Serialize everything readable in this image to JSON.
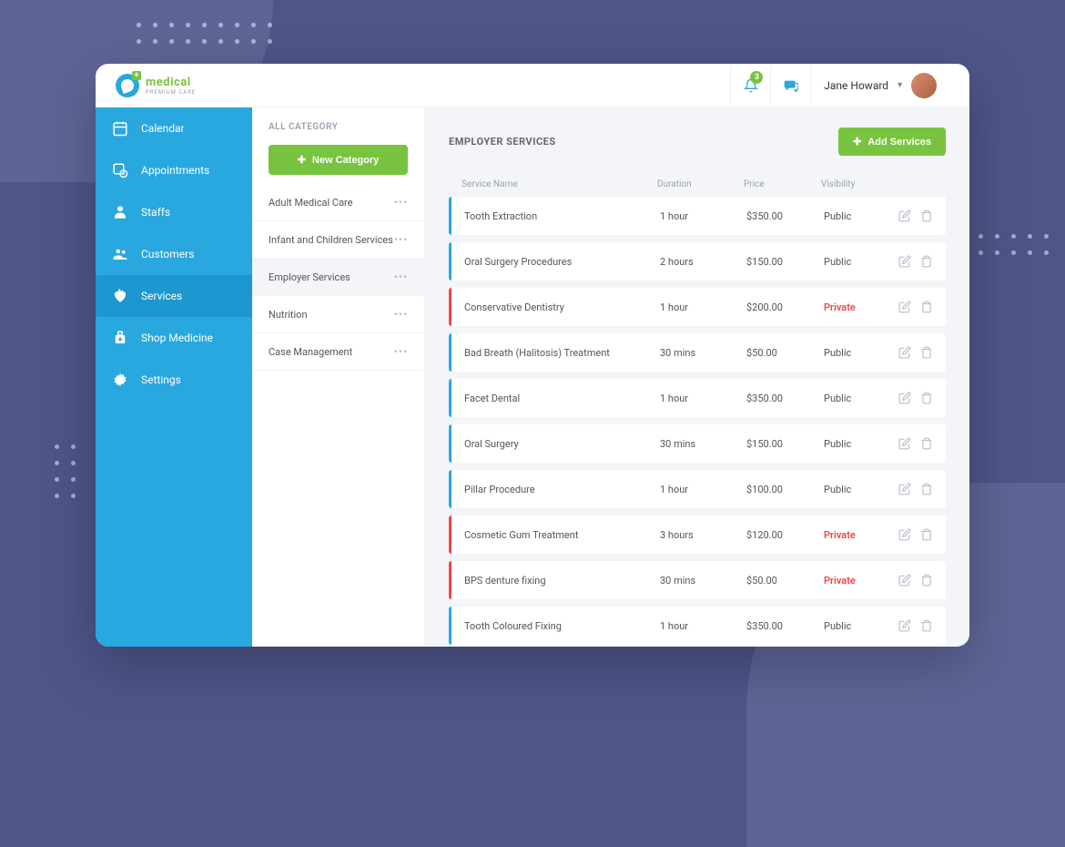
{
  "brand": {
    "name": "medical",
    "tagline": "PREMIUM CARE"
  },
  "topbar": {
    "notification_count": "3",
    "user_name": "Jane Howard"
  },
  "sidebar": {
    "items": [
      {
        "label": "Calendar"
      },
      {
        "label": "Appointments"
      },
      {
        "label": "Staffs"
      },
      {
        "label": "Customers"
      },
      {
        "label": "Services"
      },
      {
        "label": "Shop Medicine"
      },
      {
        "label": "Settings"
      }
    ]
  },
  "categories": {
    "header": "ALL CATEGORY",
    "new_button": "New Category",
    "items": [
      {
        "label": "Adult Medical Care"
      },
      {
        "label": "Infant and Children Services"
      },
      {
        "label": "Employer Services"
      },
      {
        "label": "Nutrition"
      },
      {
        "label": "Case Management"
      }
    ]
  },
  "main": {
    "title": "EMPLOYER SERVICES",
    "add_button": "Add Services",
    "columns": {
      "name": "Service Name",
      "duration": "Duration",
      "price": "Price",
      "visibility": "Visibility"
    },
    "rows": [
      {
        "name": "Tooth Extraction",
        "duration": "1 hour",
        "price": "$350.00",
        "visibility": "Public"
      },
      {
        "name": "Oral Surgery Procedures",
        "duration": "2 hours",
        "price": "$150.00",
        "visibility": "Public"
      },
      {
        "name": "Conservative Dentistry",
        "duration": "1 hour",
        "price": "$200.00",
        "visibility": "Private"
      },
      {
        "name": "Bad Breath (Halitosis) Treatment",
        "duration": "30 mins",
        "price": "$50.00",
        "visibility": "Public"
      },
      {
        "name": "Facet Dental",
        "duration": "1 hour",
        "price": "$350.00",
        "visibility": "Public"
      },
      {
        "name": "Oral Surgery",
        "duration": "30 mins",
        "price": "$150.00",
        "visibility": "Public"
      },
      {
        "name": "Pillar Procedure",
        "duration": "1 hour",
        "price": "$100.00",
        "visibility": "Public"
      },
      {
        "name": "Cosmetic Gum Treatment",
        "duration": "3 hours",
        "price": "$120.00",
        "visibility": "Private"
      },
      {
        "name": "BPS denture fixing",
        "duration": "30 mins",
        "price": "$50.00",
        "visibility": "Private"
      },
      {
        "name": "Tooth Coloured Fixing",
        "duration": "1 hour",
        "price": "$350.00",
        "visibility": "Public"
      }
    ]
  }
}
